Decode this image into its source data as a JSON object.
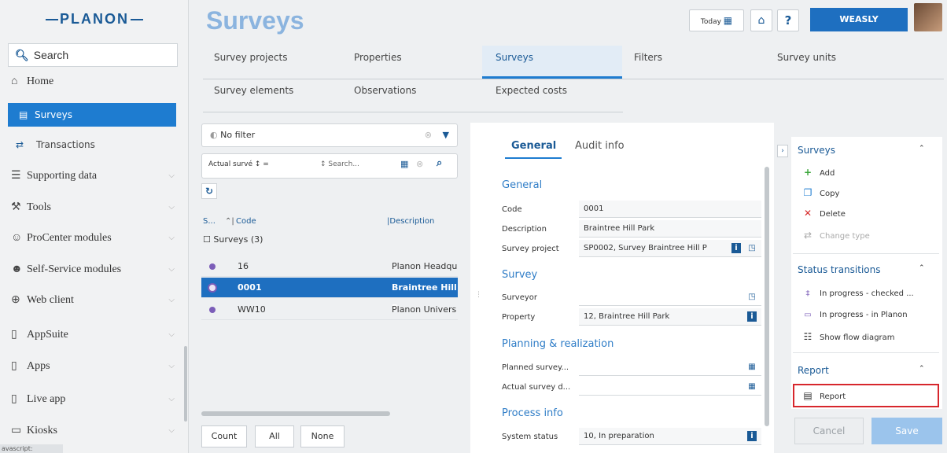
{
  "app": {
    "logo": "PLANON",
    "page_title": "Surveys",
    "status_bar": "avascript:"
  },
  "header": {
    "today_label": "Today",
    "user_label": "WEASLY",
    "help_label": "?"
  },
  "sidebar": {
    "search_label": "Search",
    "items": [
      {
        "label": "Home",
        "icon": "home-icon"
      },
      {
        "label": "Surveys",
        "icon": "survey-icon",
        "active": true
      },
      {
        "label": "Transactions",
        "icon": "transactions-icon"
      },
      {
        "label": "Supporting data",
        "icon": "database-icon"
      },
      {
        "label": "Tools",
        "icon": "wrench-icon"
      },
      {
        "label": "ProCenter modules",
        "icon": "users-icon"
      },
      {
        "label": "Self-Service modules",
        "icon": "person-icon"
      },
      {
        "label": "Web client",
        "icon": "globe-icon"
      },
      {
        "label": "AppSuite",
        "icon": "tablet-icon"
      },
      {
        "label": "Apps",
        "icon": "tablet-icon"
      },
      {
        "label": "Live app",
        "icon": "tablet-icon"
      },
      {
        "label": "Kiosks",
        "icon": "monitor-icon"
      }
    ]
  },
  "tabs": {
    "row1": [
      "Survey projects",
      "Properties",
      "Surveys",
      "Filters",
      "Survey units"
    ],
    "row2": [
      "Survey elements",
      "Observations",
      "Expected costs"
    ]
  },
  "list": {
    "filter_label": "No filter",
    "sort_field": "Actual survé ↕ =",
    "search_placeholder": "↕ Search...",
    "col_short": "S...",
    "col_code": "Code",
    "col_description": "Description",
    "group_label": "Surveys (3)",
    "rows": [
      {
        "code": "16",
        "description": "Planon Headqu"
      },
      {
        "code": "0001",
        "description": "Braintree Hill P"
      },
      {
        "code": "WW10",
        "description": "Planon Univers"
      }
    ],
    "buttons": {
      "count": "Count",
      "all": "All",
      "none": "None"
    }
  },
  "detail": {
    "tabs": {
      "general": "General",
      "audit": "Audit info"
    },
    "sections": {
      "general": "General",
      "survey": "Survey",
      "planning": "Planning & realization",
      "process": "Process info"
    },
    "fields": {
      "code_label": "Code",
      "code_value": "0001",
      "description_label": "Description",
      "description_value": "Braintree Hill Park",
      "survey_project_label": "Survey project",
      "survey_project_value": "SP0002, Survey Braintree Hill P",
      "surveyor_label": "Surveyor",
      "surveyor_value": "",
      "property_label": "Property",
      "property_value": "12, Braintree Hill Park",
      "planned_label": "Planned survey...",
      "planned_value": "",
      "actual_label": "Actual survey d...",
      "actual_value": "",
      "system_status_label": "System status",
      "system_status_value": "10, In preparation"
    }
  },
  "actions": {
    "surveys_header": "Surveys",
    "add": "Add",
    "copy": "Copy",
    "delete": "Delete",
    "change_type": "Change type",
    "status_header": "Status transitions",
    "status_checked": "In progress - checked ...",
    "status_planon": "In progress - in Planon",
    "flow_diagram": "Show flow diagram",
    "report_header": "Report",
    "report": "Report",
    "cancel": "Cancel",
    "save": "Save"
  },
  "colors": {
    "primary": "#1e7cd0",
    "selected_row": "#1e6fc0",
    "highlight": "#d7262c",
    "title": "#8bb4df"
  }
}
